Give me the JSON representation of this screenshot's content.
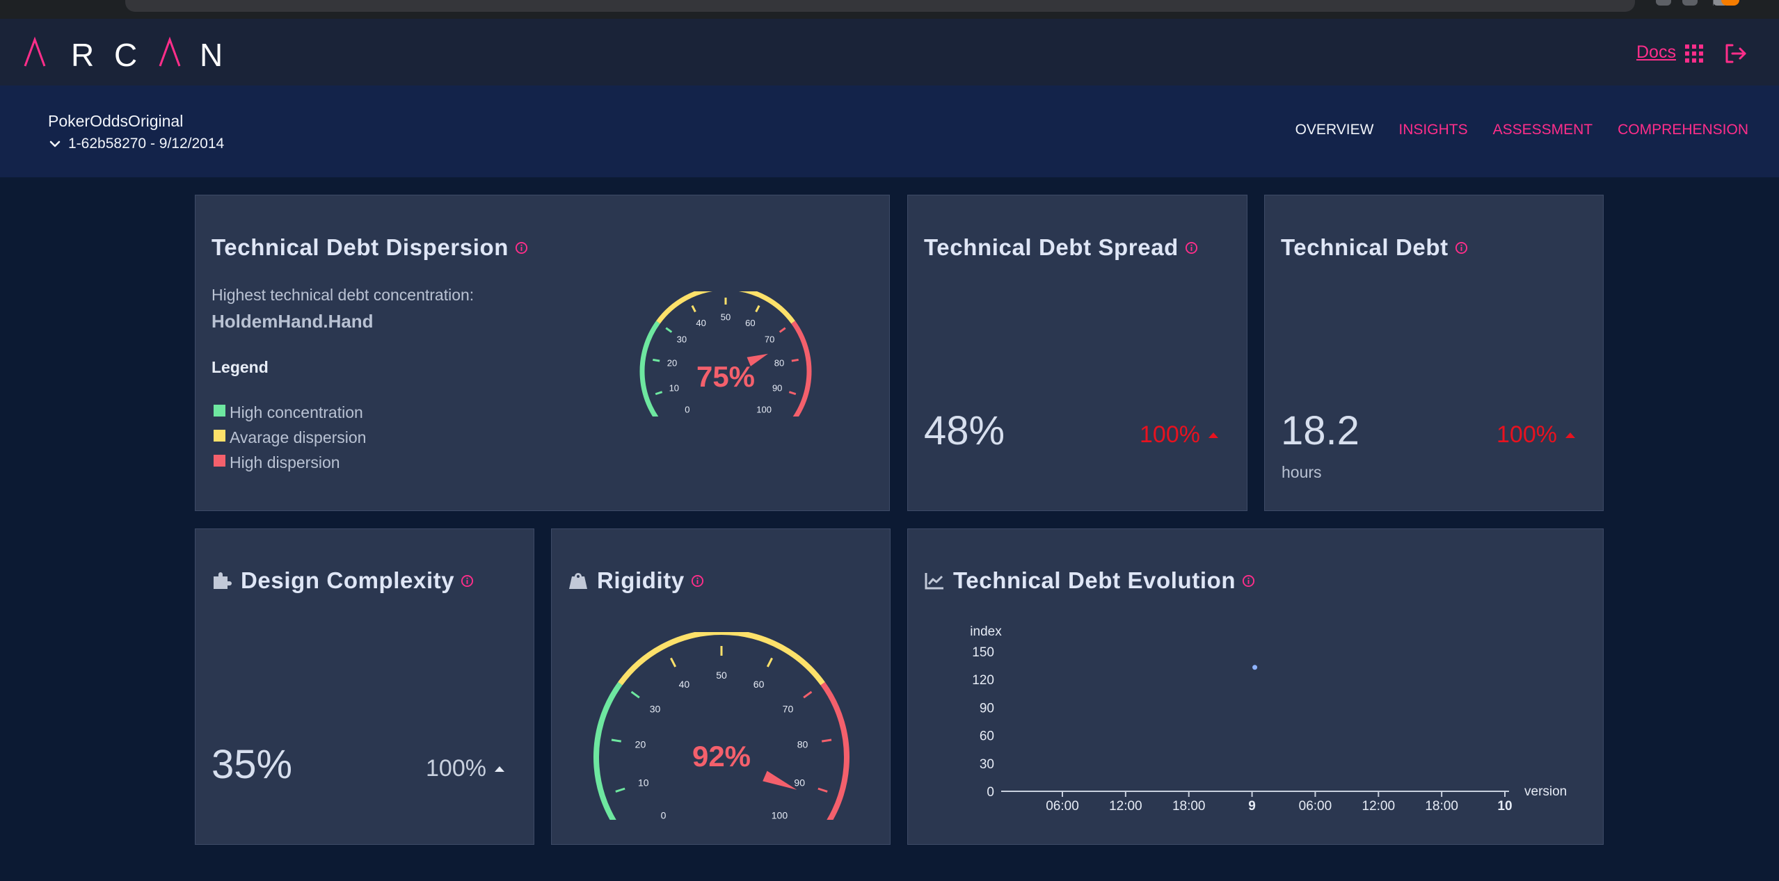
{
  "header": {
    "logo_text": "ARCAN",
    "docs_label": "Docs",
    "apps_icon": "grid-icon",
    "logout_icon": "logout-icon"
  },
  "project": {
    "name": "PokerOddsOriginal",
    "version": "1-62b58270 - 9/12/2014"
  },
  "nav": {
    "tabs": [
      {
        "label": "OVERVIEW",
        "active": true
      },
      {
        "label": "INSIGHTS",
        "active": false
      },
      {
        "label": "ASSESSMENT",
        "active": false
      },
      {
        "label": "COMPREHENSION",
        "active": false
      }
    ]
  },
  "dispersion": {
    "title": "Technical Debt Dispersion",
    "concentration_label": "Highest technical debt concentration:",
    "concentration_value": "HoldemHand.Hand",
    "legend_title": "Legend",
    "legend": [
      {
        "label": "High concentration",
        "color": "#6ee7a0"
      },
      {
        "label": "Avarage dispersion",
        "color": "#fde16a"
      },
      {
        "label": "High dispersion",
        "color": "#f4606c"
      }
    ],
    "gauge_value": 75,
    "gauge_label": "75%",
    "gauge_ticks": [
      "0",
      "10",
      "20",
      "30",
      "40",
      "50",
      "60",
      "70",
      "80",
      "90",
      "100"
    ]
  },
  "spread": {
    "title": "Technical Debt Spread",
    "value": "48%",
    "change": "100%"
  },
  "debt": {
    "title": "Technical Debt",
    "value": "18.2",
    "unit": "hours",
    "change": "100%"
  },
  "complexity": {
    "title": "Design Complexity",
    "icon": "puzzle-icon",
    "value": "35%",
    "change": "100%"
  },
  "rigidity": {
    "title": "Rigidity",
    "icon": "weight-icon",
    "gauge_value": 92,
    "gauge_label": "92%",
    "gauge_ticks": [
      "0",
      "10",
      "20",
      "30",
      "40",
      "50",
      "60",
      "70",
      "80",
      "90",
      "100"
    ]
  },
  "evolution": {
    "title": "Technical Debt Evolution",
    "icon": "chart-line-icon"
  },
  "chart_data": {
    "type": "scatter",
    "title": "Technical Debt Evolution",
    "xlabel": "version",
    "ylabel": "index",
    "x_ticks": [
      "06:00",
      "12:00",
      "18:00",
      "9",
      "06:00",
      "12:00",
      "18:00",
      "10"
    ],
    "y_ticks": [
      0,
      30,
      60,
      90,
      120,
      150
    ],
    "ylim": [
      0,
      150
    ],
    "series": [
      {
        "points": [
          {
            "x": "9",
            "y": 133
          }
        ]
      }
    ],
    "grid": false
  },
  "colors": {
    "accent": "#ff2e8a",
    "green": "#6ee7a0",
    "yellow": "#fde16a",
    "red": "#f4606c",
    "change_red": "#e8121f"
  }
}
